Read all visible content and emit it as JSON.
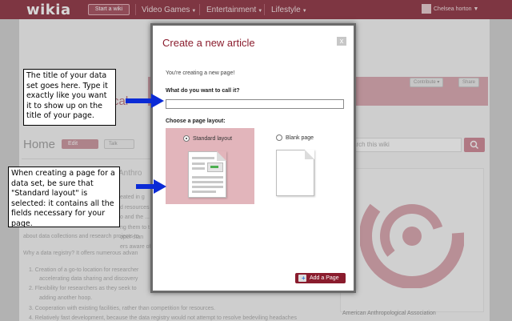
{
  "topbar": {
    "logo": "wikia",
    "start_wiki": "Start a wiki",
    "nav": [
      "Video Games",
      "Entertainment",
      "Lifestyle"
    ],
    "user": "Chelsea horton"
  },
  "background": {
    "banner_text": "cal",
    "contribute": "Contribute",
    "share": "Share",
    "home": "Home",
    "edit": "Edit",
    "talk": "Talk",
    "search_placeholder": "arch this wiki",
    "heading_fragment": "Anthro",
    "lines": [
      "eated in g",
      "d resources",
      "o and the ...",
      "ng them to t",
      "oper stan",
      "ers aware of",
      "about data collections and research projects to"
    ],
    "why_line": "Why a data registry? It offers numerous advan",
    "list": [
      "Creation of a go-to location for researcher",
      "accelerating data sharing and discovery",
      "Flexibility for researchers as they seek to",
      "adding another hoop.",
      "Cooperation with existing facilities, rather than competition for resources.",
      "Relatively fast development, because the data registry would not attempt to resolve bedeviling headaches"
    ],
    "right_caption": "American Anthropological Association"
  },
  "modal": {
    "title": "Create a new article",
    "close": "x",
    "subtitle": "You're creating a new page!",
    "question_name": "What do you want to call it?",
    "title_value": "",
    "question_layout": "Choose a page layout:",
    "options": [
      {
        "label": "Standard layout",
        "selected": true
      },
      {
        "label": "Blank page",
        "selected": false
      }
    ],
    "add_page": "Add a Page"
  },
  "callouts": [
    "The title of your data set goes here. Type it exactly like you want it to show up on the title of your page.",
    "When creating a page for a data set, be sure that \"Standard layout\" is selected: it contains all the fields necessary for your page."
  ],
  "colors": {
    "brand": "#8a2a3a",
    "accent": "#8a1c2d",
    "highlight": "#e2b5bb",
    "arrow": "#0b2bd6"
  }
}
